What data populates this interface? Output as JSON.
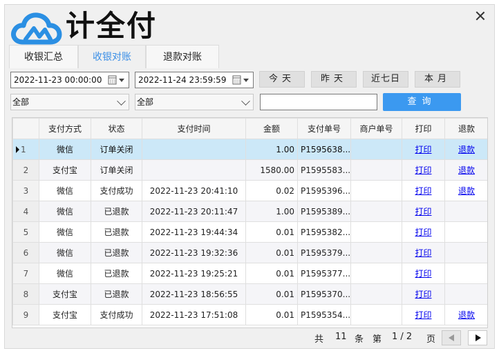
{
  "app": {
    "logo_text": "计全付"
  },
  "tabs": [
    {
      "label": "收银汇总"
    },
    {
      "label": "收银对账"
    },
    {
      "label": "退款对账"
    }
  ],
  "filters": {
    "start_time": "2022-11-23 00:00:00",
    "end_time": "2022-11-24 23:59:59",
    "today_label": "今天",
    "yesterday_label": "昨天",
    "last7_label": "近七日",
    "month_label": "本月",
    "select1_value": "全部",
    "select2_value": "全部",
    "search_value": "",
    "query_label": "查询"
  },
  "table": {
    "columns": [
      "",
      "支付方式",
      "状态",
      "支付时间",
      "金额",
      "支付单号",
      "商户单号",
      "打印",
      "退款"
    ],
    "rows": [
      {
        "no": "1",
        "pay": "微信",
        "status": "订单关闭",
        "time": "",
        "amount": "1.00",
        "order": "P1595638...",
        "merchant": "",
        "print": "打印",
        "refund": "退款"
      },
      {
        "no": "2",
        "pay": "支付宝",
        "status": "订单关闭",
        "time": "",
        "amount": "1580.00",
        "order": "P1595583...",
        "merchant": "",
        "print": "打印",
        "refund": "退款"
      },
      {
        "no": "3",
        "pay": "微信",
        "status": "支付成功",
        "time": "2022-11-23 20:41:10",
        "amount": "0.02",
        "order": "P1595396...",
        "merchant": "",
        "print": "打印",
        "refund": "退款"
      },
      {
        "no": "4",
        "pay": "微信",
        "status": "已退款",
        "time": "2022-11-23 20:11:47",
        "amount": "1.00",
        "order": "P1595389...",
        "merchant": "",
        "print": "打印",
        "refund": ""
      },
      {
        "no": "5",
        "pay": "微信",
        "status": "已退款",
        "time": "2022-11-23 19:44:34",
        "amount": "0.01",
        "order": "P1595382...",
        "merchant": "",
        "print": "打印",
        "refund": ""
      },
      {
        "no": "6",
        "pay": "微信",
        "status": "已退款",
        "time": "2022-11-23 19:32:36",
        "amount": "0.01",
        "order": "P1595379...",
        "merchant": "",
        "print": "打印",
        "refund": ""
      },
      {
        "no": "7",
        "pay": "微信",
        "status": "已退款",
        "time": "2022-11-23 19:25:21",
        "amount": "0.01",
        "order": "P1595377...",
        "merchant": "",
        "print": "打印",
        "refund": ""
      },
      {
        "no": "8",
        "pay": "支付宝",
        "status": "已退款",
        "time": "2022-11-23 18:56:55",
        "amount": "0.01",
        "order": "P1595370...",
        "merchant": "",
        "print": "打印",
        "refund": ""
      },
      {
        "no": "9",
        "pay": "支付宝",
        "status": "支付成功",
        "time": "2022-11-23 17:51:08",
        "amount": "0.01",
        "order": "P1595354...",
        "merchant": "",
        "print": "打印",
        "refund": "退款"
      }
    ]
  },
  "pager": {
    "total_prefix": "共",
    "total_count": "11",
    "total_suffix": "条",
    "page_prefix": "第",
    "page_text": "1 / 2",
    "page_suffix": "页"
  },
  "colors": {
    "accent": "#3b99f0",
    "selected_row": "#cce8f8",
    "logo_blue": "#2b8fe3"
  }
}
